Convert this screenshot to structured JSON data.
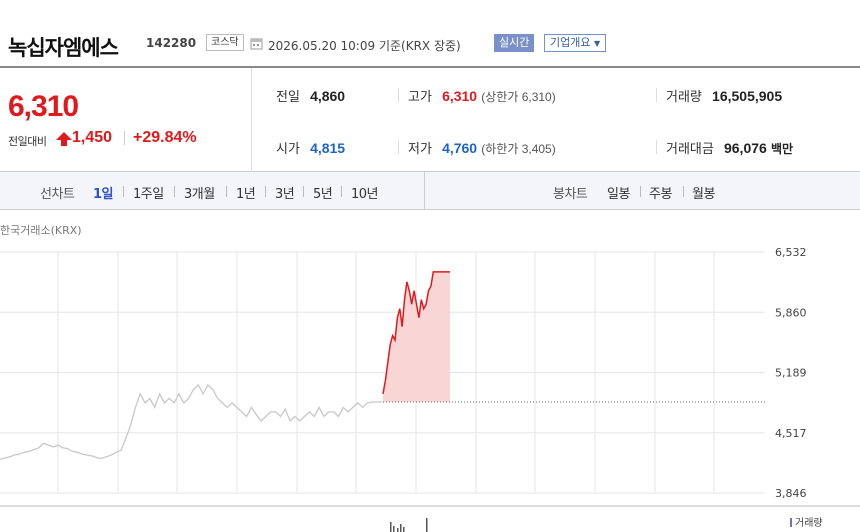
{
  "header": {
    "stock_name": "녹십자엠에스",
    "stock_code": "142280",
    "market": "코스닥",
    "datetime": "2026.05.20 10:09",
    "basis": "기준(KRX 장중)",
    "realtime_label": "실시간",
    "company_label": "기업개요"
  },
  "price": {
    "current": "6,310",
    "change_label": "전일대비",
    "change": "1,450",
    "change_pct": "+29.84%"
  },
  "stats": {
    "prev_close_label": "전일",
    "prev_close": "4,860",
    "high_label": "고가",
    "high": "6,310",
    "upper_limit_text": "(상한가 6,310)",
    "volume_label": "거래량",
    "volume": "16,505,905",
    "open_label": "시가",
    "open": "4,815",
    "low_label": "저가",
    "low": "4,760",
    "lower_limit_text": "(하한가 3,405)",
    "amount_label": "거래대금",
    "amount": "96,076",
    "amount_unit": "백만"
  },
  "tabs": {
    "line_chart_label": "선차트",
    "periods": [
      "1일",
      "1주일",
      "3개월",
      "1년",
      "3년",
      "5년",
      "10년"
    ],
    "active_period": "1일",
    "candle_chart_label": "봉차트",
    "candle_periods": [
      "일봉",
      "주봉",
      "월봉"
    ]
  },
  "chart": {
    "source": "한국거래소(KRX)",
    "volume_label": "거래량",
    "colors": {
      "up": "#e0191c",
      "grey_line": "#c8c8c8",
      "fill": "#f9d6d6"
    }
  },
  "chart_data": {
    "type": "line",
    "title": "",
    "yticks": [
      6532,
      5860,
      5189,
      4517,
      3846
    ],
    "ylim": [
      3846,
      6532
    ],
    "grid": true,
    "reference_line": 4860,
    "series": [
      {
        "values": [
          4220,
          4235,
          4250,
          4270,
          4280,
          4300,
          4310,
          4330,
          4350,
          4400,
          4380,
          4360,
          4380,
          4350,
          4340,
          4310,
          4300,
          4280,
          4270,
          4260,
          4240,
          4230,
          4250,
          4270,
          4300,
          4320,
          4450,
          4600,
          4800,
          4950,
          4850,
          4900,
          4800,
          4950,
          4850,
          4900,
          4850,
          4950,
          4850,
          4900,
          5000,
          5050,
          4950,
          5050,
          5000,
          4900,
          4850,
          4800,
          4850,
          4800,
          4750,
          4700,
          4800,
          4720,
          4650,
          4700,
          4750,
          4750,
          4700,
          4780,
          4650,
          4700,
          4650,
          4700,
          4750,
          4700,
          4800,
          4700,
          4750,
          4750,
          4700,
          4800,
          4750,
          4800,
          4850,
          4800,
          4850,
          4860,
          4860,
          4860
        ]
      },
      {
        "values": [
          4950,
          5100,
          5300,
          5500,
          5600,
          5550,
          5800,
          5900,
          5700,
          6000,
          6200,
          6100,
          5950,
          6100,
          5950,
          5800,
          6000,
          5900,
          5950,
          6100,
          6150,
          6310,
          6310,
          6310,
          6310,
          6310,
          6310,
          6310,
          6310
        ]
      }
    ]
  }
}
